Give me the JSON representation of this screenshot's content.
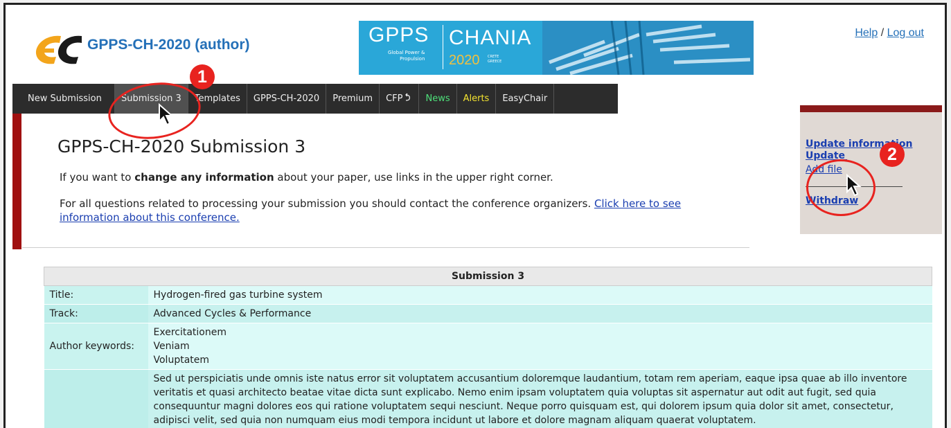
{
  "header": {
    "app_title": "GPPS-CH-2020 (author)",
    "help_link": "Help",
    "separator": "/",
    "logout_link": "Log out",
    "banner": {
      "gpps": "GPPS",
      "gpps_sub_line1": "Global Power &",
      "gpps_sub_line2": "Propulsion",
      "chania": "CHANIA",
      "year": "2020",
      "place_line1": "CRETE",
      "place_line2": "GREECE"
    }
  },
  "menu": {
    "items": [
      "New Submission",
      "Submission 3",
      "Templates",
      "GPPS-CH-2020",
      "Premium",
      "CFP",
      "News",
      "Alerts",
      "EasyChair"
    ]
  },
  "main": {
    "title": "GPPS-CH-2020 Submission 3",
    "p1_pre": "If you want to ",
    "p1_bold": "change any information",
    "p1_post": " about your paper, use links in the upper right corner.",
    "p2_text": "For all questions related to processing your submission you should contact the conference organizers. ",
    "p2_link": "Click here to see information about this conference."
  },
  "side_panel": {
    "update_information": "Update information",
    "update_authors": "Update authors",
    "add_file": "Add file",
    "withdraw": "Withdraw"
  },
  "annotations": {
    "badge1": "1",
    "badge2": "2"
  },
  "table": {
    "heading": "Submission 3",
    "title_label": "Title:",
    "title_value": "Hydrogen-fired gas turbine system",
    "track_label": "Track:",
    "track_value": "Advanced Cycles & Performance",
    "keywords_label": "Author keywords:",
    "keywords": [
      "Exercitationem",
      "Veniam",
      "Voluptatem"
    ],
    "abstract": "Sed ut perspiciatis unde omnis iste natus error sit voluptatem accusantium doloremque laudantium, totam rem aperiam, eaque ipsa quae ab illo inventore veritatis et quasi architecto beatae vitae dicta sunt explicabo. Nemo enim ipsam voluptatem quia voluptas sit aspernatur aut odit aut fugit, sed quia consequuntur magni dolores eos qui ratione voluptatem sequi nesciunt. Neque porro quisquam est, qui dolorem ipsum quia dolor sit amet, consectetur, adipisci velit, sed quia non numquam eius modi tempora incidunt ut labore et dolore magnam aliquam quaerat voluptatem."
  },
  "colors": {
    "brand_blue": "#2470b8",
    "menu_bg": "#2c2c2c",
    "accent_red": "#a01010",
    "annotation_red": "#e8231f",
    "news_green": "#4ee07a",
    "alerts_yellow": "#f4e430"
  }
}
